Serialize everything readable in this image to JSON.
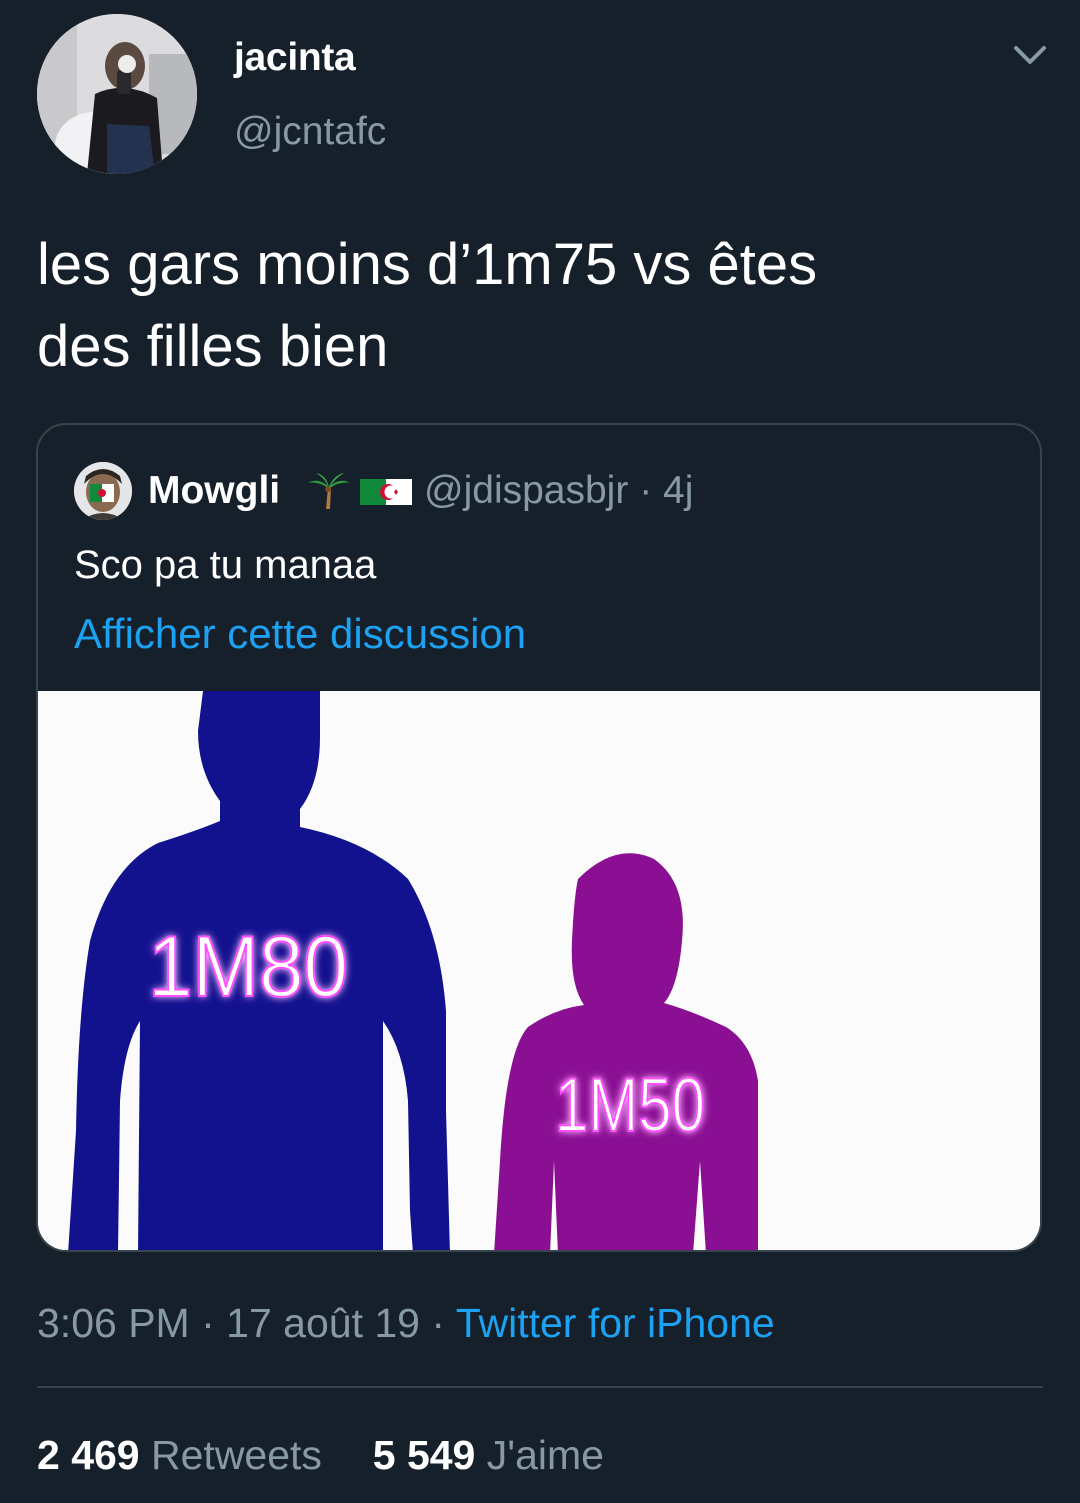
{
  "author": {
    "display_name": "jacinta",
    "handle": "@jcntafc"
  },
  "tweet": {
    "text_line1": "les gars moins d’1m75 vs êtes",
    "text_line2": "des filles bien"
  },
  "quoted": {
    "display_name": "Mowgli",
    "emoji": [
      "palm-tree-emoji",
      "algeria-flag-emoji"
    ],
    "handle": "@jdispasbjr",
    "separator": "·",
    "age": "4j",
    "text": "Sco pa tu manaa",
    "show_thread": "Afficher cette discussion",
    "media": {
      "tall_label": "1M80",
      "short_label": "1M50",
      "colors": {
        "tall": "#12128f",
        "short": "#8a0f93",
        "label_glow": "#ff4dff"
      }
    }
  },
  "meta": {
    "time": "3:06 PM",
    "date": "17 août 19",
    "source": "Twitter for iPhone",
    "separator": "·"
  },
  "stats": {
    "retweets_count": "2 469",
    "retweets_label": "Retweets",
    "likes_count": "5 549",
    "likes_label": "J'aime"
  },
  "colors": {
    "background": "#15202b",
    "link": "#1da1f2",
    "secondary_text": "#8899a6",
    "border": "#38444d"
  }
}
